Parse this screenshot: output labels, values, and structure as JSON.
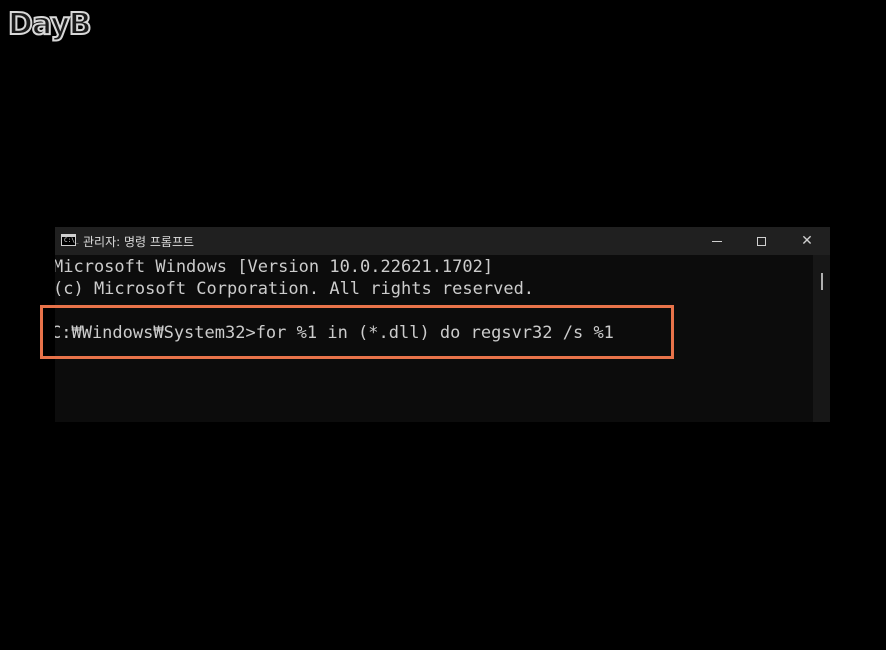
{
  "logo": {
    "text": "DayB"
  },
  "window": {
    "title": "관리자: 명령 프롬프트",
    "icon_label": "C:\\_",
    "controls": {
      "minimize": "minimize-icon",
      "maximize": "maximize-icon",
      "close": "✕"
    }
  },
  "console": {
    "lines": [
      "Microsoft Windows [Version 10.0.22621.1702]",
      "(c) Microsoft Corporation. All rights reserved.",
      "C:₩Windows₩System32>for %1 in (*.dll) do regsvr32 /s %1"
    ]
  },
  "colors": {
    "highlight": "#e8734a",
    "titlebar": "#202020",
    "console_bg": "#0c0c0c",
    "console_text": "#cccccc"
  }
}
